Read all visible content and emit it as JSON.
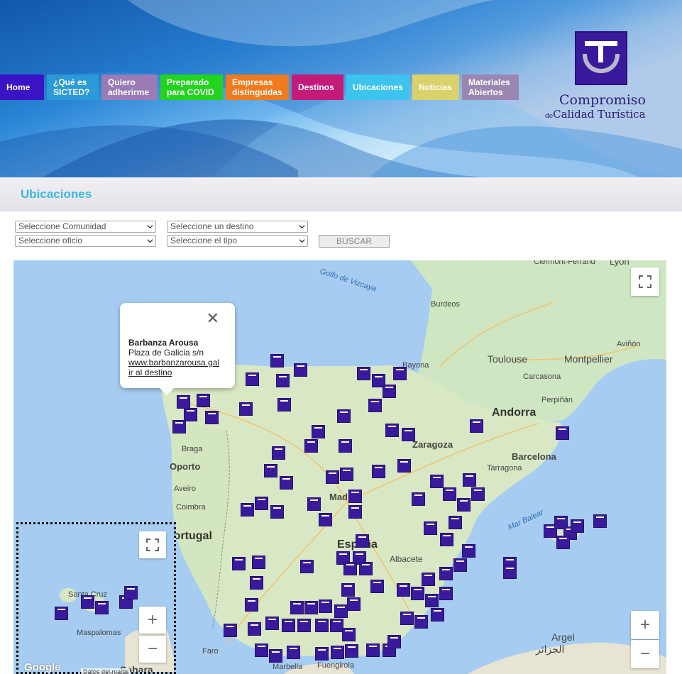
{
  "nav": [
    {
      "label": "Home",
      "color": "#3a14c4"
    },
    {
      "label": "¿Qué es\nSICTED?",
      "color": "#2b9ad6"
    },
    {
      "label": "Quiero\nadherirme",
      "color": "#9a7bb6"
    },
    {
      "label": "Preparado\npara COVID",
      "color": "#22d41e"
    },
    {
      "label": "Empresas\ndistinguidas",
      "color": "#f07a1e"
    },
    {
      "label": "Destinos",
      "color": "#c41a78"
    },
    {
      "label": "Ubicaciones",
      "color": "#3cc4ee"
    },
    {
      "label": "Noticias",
      "color": "#d9d16a"
    },
    {
      "label": "Materiales\nAbiertos",
      "color": "#9b86b2"
    }
  ],
  "logo": {
    "line1": "Compromiso",
    "line2_prefix": "de",
    "line2": "Calidad Turística"
  },
  "section_title": "Ubicaciones",
  "filters": {
    "comunidad": "Seleccione Comunidad",
    "destino": "Seleccione un destino",
    "oficio": "Seleccione oficio",
    "tipo": "Seleccione el tipo",
    "search_label": "BUSCAR"
  },
  "popup": {
    "title": "Barbanza Arousa",
    "address": "Plaza de Galicia s/n",
    "link": "www.barbanzarousa.gal",
    "destination_link": "ir al destino"
  },
  "map_labels": {
    "vizcaya": "Golfo de Vizcaya",
    "mar_balear": "Mar Balear",
    "lyon": "Lyon",
    "clermont": "Clermont-Ferrand",
    "burdeos": "Burdeos",
    "avinon": "Aviñón",
    "toulouse": "Toulouse",
    "montpellier": "Montpellier",
    "carcasona": "Carcasona",
    "perpinan": "Perpiñán",
    "bayona": "Bayona",
    "andorra": "Andorra",
    "zaragoza": "Zaragoza",
    "barcelona": "Barcelona",
    "tarragona": "Tarragona",
    "braga": "Braga",
    "oporto": "Oporto",
    "aveiro": "Aveiro",
    "coimbra": "Coimbra",
    "portugal": "Portugal",
    "espana": "España",
    "albacete": "Albacete",
    "faro": "Faro",
    "marbella": "Marbella",
    "fuengirola": "Fuengirola",
    "argel": "Argel",
    "argel_ar": "الجزائر",
    "santa_cruz": "Santa Cruz",
    "maspalomas": "Maspalomas",
    "sahara": "Sahara",
    "madrid": "Madrid",
    "google": "Google",
    "map_data": "Datos del mapa"
  }
}
